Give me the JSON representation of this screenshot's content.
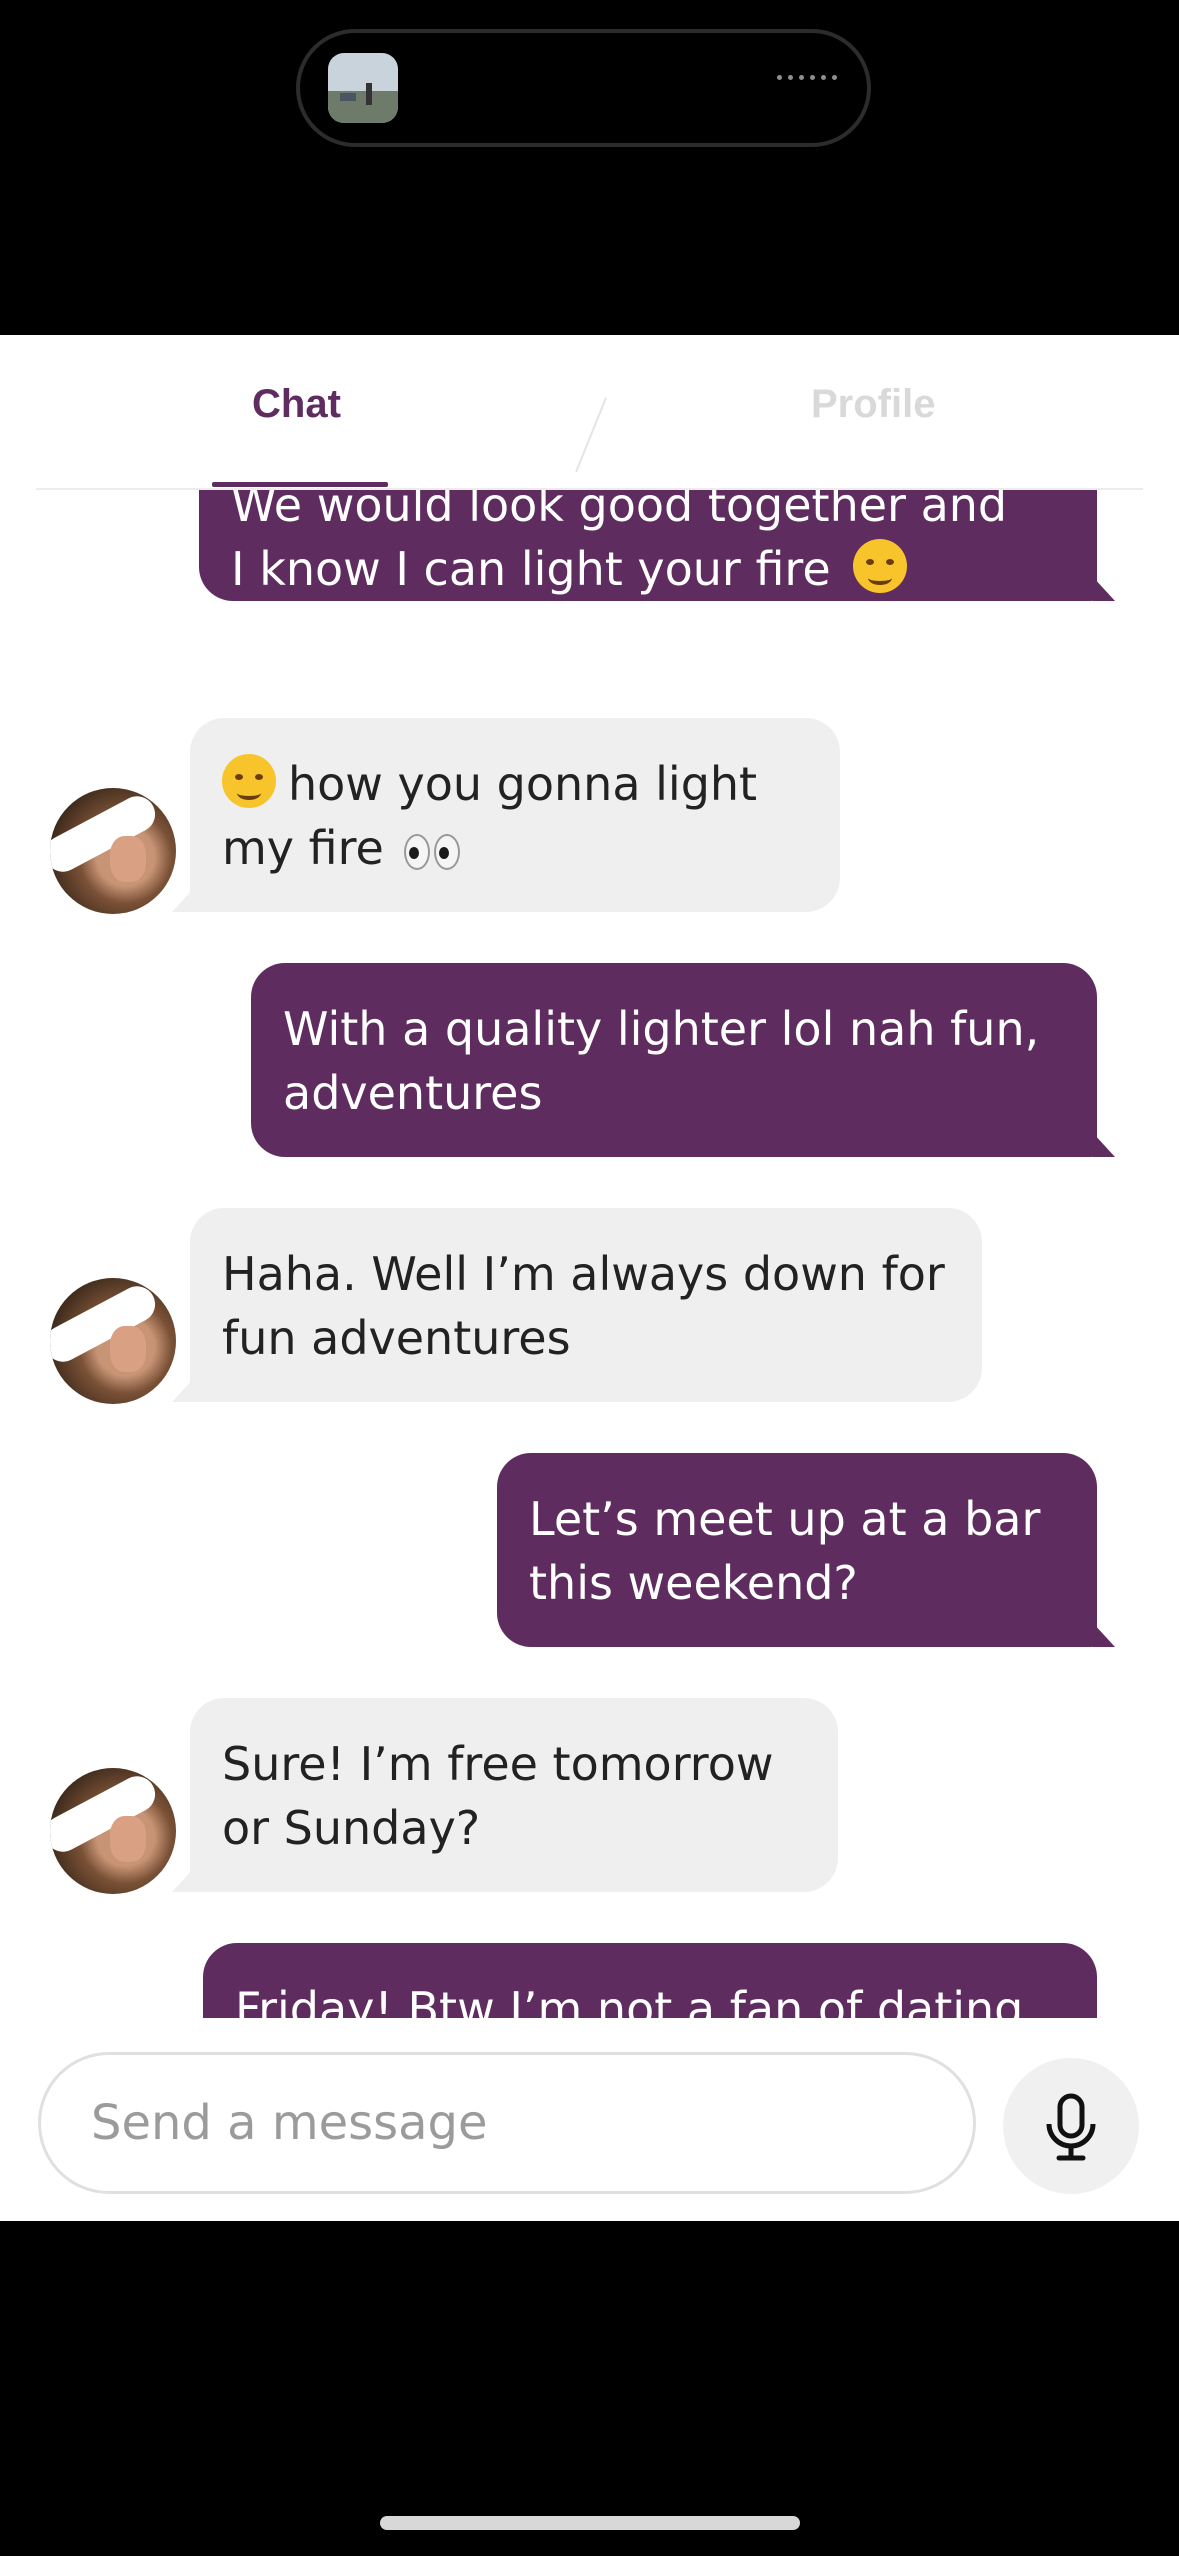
{
  "tabs": {
    "chat": "Chat",
    "profile": "Profile"
  },
  "messages": [
    {
      "from": "me",
      "line1": "We would look good together and",
      "line2": "I know I can light your fire",
      "emoji": "winking-face-emoji"
    },
    {
      "from": "them",
      "line1": "how you gonna light",
      "line2": "my fire",
      "lead_emoji": "smirking-face-emoji",
      "trail_emoji": "eyes-emoji"
    },
    {
      "from": "me",
      "line1": "With a quality lighter lol nah fun,",
      "line2": "adventures"
    },
    {
      "from": "them",
      "line1": "Haha. Well I’m always down for",
      "line2": "fun adventures"
    },
    {
      "from": "me",
      "line1": "Let’s meet up at a bar",
      "line2": "this weekend?"
    },
    {
      "from": "them",
      "line1": "Sure! I’m free tomorrow",
      "line2": "or Sunday?"
    },
    {
      "from": "me",
      "line1": "Friday! Btw I’m not a fan of dating"
    }
  ],
  "composer": {
    "placeholder": "Send a message"
  },
  "colors": {
    "brand": "#5f2c5f",
    "received_bubble": "#efefef",
    "tab_inactive": "#d9d9d9"
  }
}
